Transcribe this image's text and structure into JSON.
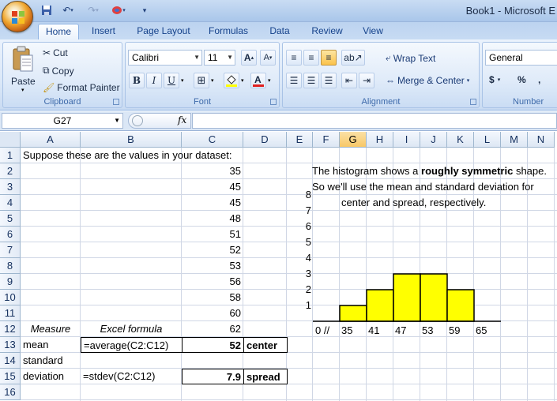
{
  "window": {
    "title": "Book1 - Microsoft E"
  },
  "tabs": [
    {
      "label": "Home"
    },
    {
      "label": "Insert"
    },
    {
      "label": "Page Layout"
    },
    {
      "label": "Formulas"
    },
    {
      "label": "Data"
    },
    {
      "label": "Review"
    },
    {
      "label": "View"
    }
  ],
  "clipboard": {
    "paste": "Paste",
    "cut": "Cut",
    "copy": "Copy",
    "format_painter": "Format Painter",
    "label": "Clipboard"
  },
  "font": {
    "name": "Calibri",
    "size": "11",
    "grow": "A",
    "shrink": "A",
    "bold": "B",
    "italic": "I",
    "underline": "U",
    "label": "Font"
  },
  "alignment": {
    "wrap": "Wrap Text",
    "merge": "Merge & Center",
    "label": "Alignment"
  },
  "number": {
    "format": "General",
    "currency": "$",
    "percent": "%",
    "comma": ",",
    "label": "Number"
  },
  "formula_bar": {
    "name_box": "G27",
    "fx": "fx",
    "formula": ""
  },
  "columns": [
    "A",
    "B",
    "C",
    "D",
    "E",
    "F",
    "G",
    "H",
    "I",
    "J",
    "K",
    "L",
    "M",
    "N"
  ],
  "rows": [
    "1",
    "2",
    "3",
    "4",
    "5",
    "6",
    "7",
    "8",
    "9",
    "10",
    "11",
    "12",
    "13",
    "14",
    "15",
    "16"
  ],
  "cells": {
    "a1": "Suppose these are the values in your dataset:",
    "c_values": [
      "35",
      "45",
      "45",
      "48",
      "51",
      "52",
      "53",
      "56",
      "58",
      "60",
      "62"
    ],
    "a12": "Measure",
    "b12": "Excel formula",
    "a13": "mean",
    "b13": "=average(C2:C12)",
    "c13": "52",
    "d13": "center",
    "a14": "standard",
    "a15": "deviation",
    "b15": "=stdev(C2:C12)",
    "c15": "7.9",
    "d15": "spread"
  },
  "note": {
    "line1_pre": "The histogram shows a ",
    "line1_bold": "roughly symmetric",
    "line1_post": " shape.",
    "line2": "So we'll use the mean and standard deviation for",
    "line3": "center and spread, respectively."
  },
  "colors": {
    "bar_fill": "#ffff00",
    "bar_stroke": "#000000",
    "selected_header": "#f8c866"
  },
  "chart_data": {
    "type": "bar",
    "categories": [
      "35",
      "41",
      "47",
      "53",
      "59"
    ],
    "values": [
      1,
      2,
      3,
      3,
      2
    ],
    "x_tick_labels": [
      "0 //",
      "35",
      "41",
      "47",
      "53",
      "59",
      "65"
    ],
    "y_tick_labels": [
      "1",
      "2",
      "3",
      "4",
      "5",
      "6",
      "7",
      "8"
    ],
    "ylim": [
      0,
      8
    ],
    "title": "",
    "xlabel": "",
    "ylabel": "",
    "grid": false
  }
}
